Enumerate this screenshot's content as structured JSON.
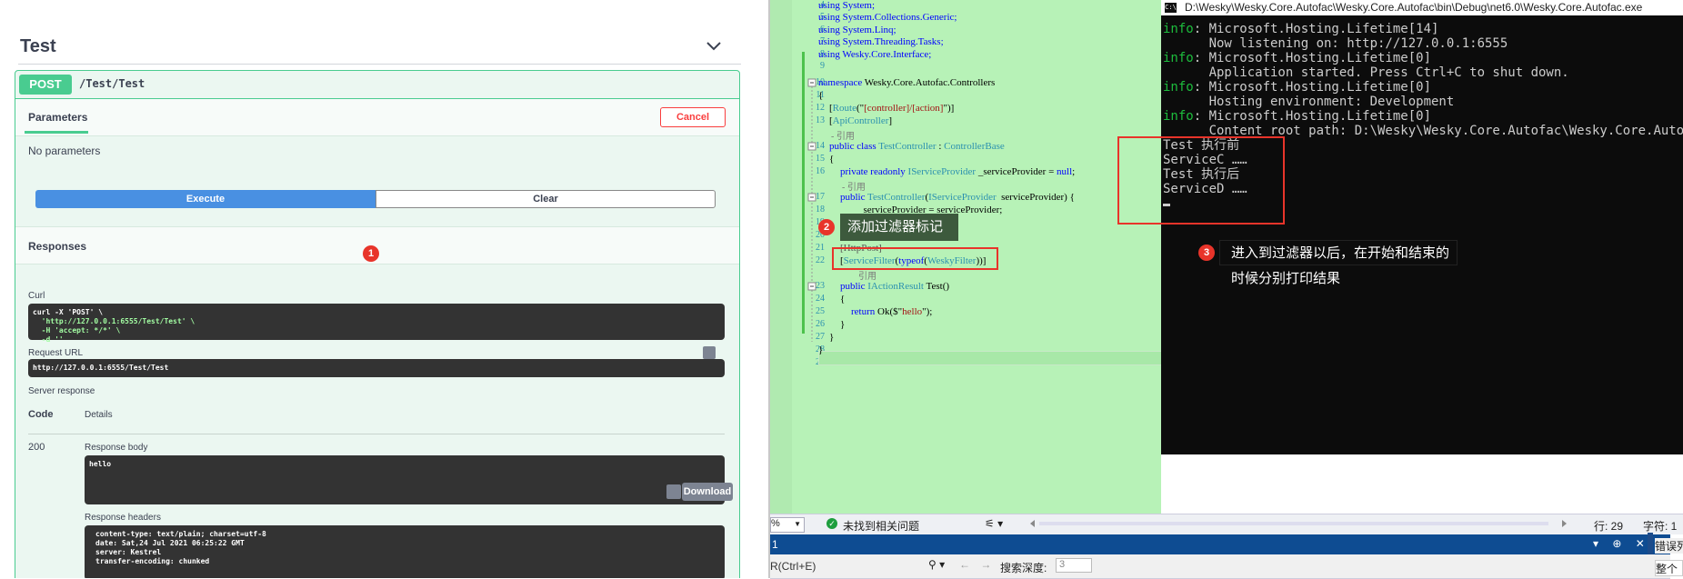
{
  "swagger": {
    "section_title": "Test",
    "operation": {
      "method": "POST",
      "path": "/Test/Test"
    },
    "parameters": {
      "tab_label": "Parameters",
      "cancel_label": "Cancel",
      "empty_text": "No parameters"
    },
    "buttons": {
      "execute": "Execute",
      "clear": "Clear"
    },
    "responses": {
      "title": "Responses",
      "curl_label": "Curl",
      "curl_lines": [
        "curl -X 'POST' \\",
        "  'http://127.0.0.1:6555/Test/Test' \\",
        "  -H 'accept: */*' \\",
        "  -d ''"
      ],
      "request_url_label": "Request URL",
      "request_url": "http://127.0.0.1:6555/Test/Test",
      "server_response_label": "Server response",
      "code_header": "Code",
      "details_header": "Details",
      "status_code": "200",
      "response_body_label": "Response body",
      "response_body": "hello",
      "download_label": "Download",
      "response_headers_label": "Response headers",
      "response_headers": [
        "content-type: text/plain; charset=utf-8",
        "date: Sat,24 Jul 2021 06:25:22 GMT",
        "server: Kestrel",
        "transfer-encoding: chunked"
      ]
    },
    "badge_1": "1"
  },
  "editor": {
    "line_numbers": [
      "4",
      "5",
      "6",
      "7",
      "8",
      "9",
      "10",
      "11",
      "12",
      "13",
      "14",
      "15",
      "16",
      "17",
      "18",
      "19",
      "20",
      "21",
      "22",
      "23",
      "24",
      "25",
      "26",
      "27",
      "28",
      "29"
    ],
    "lines": {
      "l4": "using System;",
      "l5": "using System.Collections.Generic;",
      "l6": "using System.Linq;",
      "l7": "using System.Threading.Tasks;",
      "l8": "using Wesky.Core.Interface;",
      "l10_kw": "namespace",
      "l10_rest": " Wesky.Core.Autofac.Controllers",
      "l11": "{",
      "l12_a": "[",
      "l12_b": "Route",
      "l12_c": "(\"",
      "l12_d": "[controller]/[action]",
      "l12_e": "\")]",
      "l13_a": "[",
      "l13_b": "ApiController",
      "l13_c": "]",
      "ref_1": "- 引用",
      "l14_kw": "public class",
      "l14_ty": " TestController",
      "l14_rest": " : ",
      "l14_base": "ControllerBase",
      "l15": "{",
      "l16_kw": "private readonly",
      "l16_ty": " IServiceProvider",
      "l16_rest": " _serviceProvider = ",
      "l16_null": "null",
      "l16_end": ";",
      "ref_2": "- 引用",
      "l17_kw": "public",
      "l17_ty": " TestController",
      "l17_rest": "(",
      "l17_ty2": "IServiceProvider",
      "l17_end": "  serviceProvider) {",
      "l18": "_serviceProvider = serviceProvider;",
      "l19": "}",
      "l21": "[HttpPost]",
      "l22_a": "[",
      "l22_b": "ServiceFilter",
      "l22_c": "(",
      "l22_d": "typeof",
      "l22_e": "(",
      "l22_f": "WeskyFilter",
      "l22_g": "))]",
      "ref_3": "引用",
      "l23_kw": "public",
      "l23_ty": " IActionResult",
      "l23_rest": " Test()",
      "l24": "{",
      "l25_kw": "return",
      "l25_rest": " Ok($\"",
      "l25_str": "hello",
      "l25_end": "\");",
      "l26": "}",
      "l27": "}",
      "l28": "}"
    },
    "tooltip": "添加过滤器标记",
    "badge_2": "2"
  },
  "console": {
    "title": "D:\\Wesky\\Wesky.Core.Autofac\\Wesky.Core.Autofac\\bin\\Debug\\net6.0\\Wesky.Core.Autofac.exe",
    "icon_text": "C:\\",
    "info_prefix": "info",
    "lines": [
      ": Microsoft.Hosting.Lifetime[14]",
      "      Now listening on: http://127.0.0.1:6555",
      ": Microsoft.Hosting.Lifetime[0]",
      "      Application started. Press Ctrl+C to shut down.",
      ": Microsoft.Hosting.Lifetime[0]",
      "      Hosting environment: Development",
      ": Microsoft.Hosting.Lifetime[0]",
      "      Content root path: D:\\Wesky\\Wesky.Core.Autofac\\Wesky.Core.Autofac",
      "Test 执行前",
      "ServiceC ……",
      "Test 执行后",
      "ServiceD ……"
    ],
    "annotation": "进入到过滤器以后，在开始和结束的时候分别打印结果",
    "badge_3": "3"
  },
  "status_bar": {
    "zoom": "%",
    "issues": "未找到相关问题",
    "line": "行: 29",
    "col": "字符: 1"
  },
  "tool_window": {
    "header_num": "1",
    "header_controls": "▾ ⊕ ✕",
    "search_placeholder": "R(Ctrl+E)",
    "depth_label": "搜索深度:",
    "depth_value": "3",
    "right_title": "错误列",
    "right_sub": "整个"
  },
  "colors": {
    "swagger_post": "#49cc90",
    "execute_blue": "#4990e2",
    "cancel_red": "#f93e3e",
    "annotation_red": "#e8342a",
    "editor_bg": "#b7f2b7",
    "console_bg": "#0c0c0c",
    "info_green": "#1dbd3d"
  }
}
